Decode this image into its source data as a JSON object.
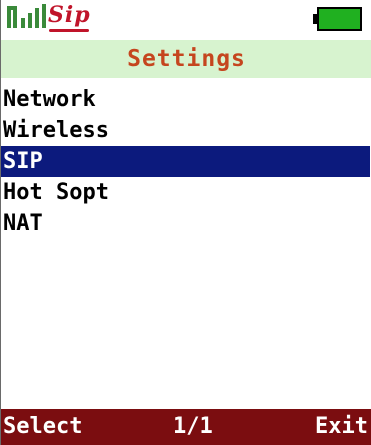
{
  "status": {
    "signal_icon": "signal-strength-icon",
    "logo_text": "Sip",
    "battery_icon": "battery-icon",
    "colors": {
      "signal": "#3a8a3a",
      "logo": "#c0142a",
      "battery": "#20b020"
    }
  },
  "title": "Settings",
  "menu": {
    "items": [
      {
        "label": "Network"
      },
      {
        "label": "Wireless"
      },
      {
        "label": "SIP"
      },
      {
        "label": "Hot Sopt"
      },
      {
        "label": "NAT"
      }
    ],
    "selected": "SIP"
  },
  "softkeys": {
    "left": "Select",
    "center": "1/1",
    "right": "Exit"
  },
  "colors": {
    "title_bg": "#d7f3cf",
    "title_text": "#c5451e",
    "selection_bg": "#0c1a7d",
    "softbar_bg": "#7b0d10"
  }
}
